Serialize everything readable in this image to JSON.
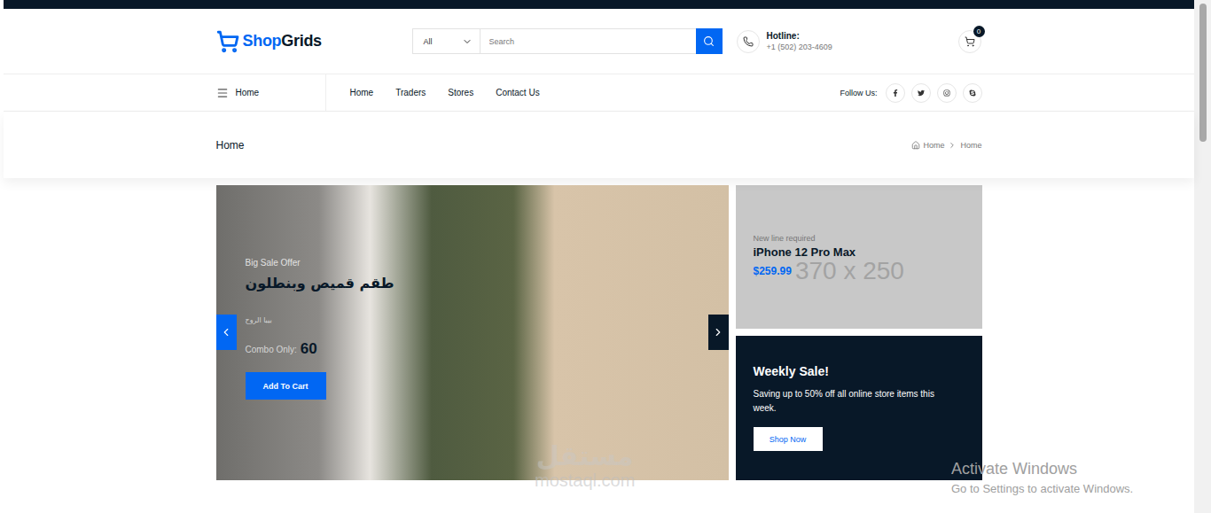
{
  "header": {
    "logo": {
      "first": "Shop",
      "second": "Grids"
    },
    "search": {
      "category": "All",
      "placeholder": "Search"
    },
    "hotline": {
      "label": "Hotline:",
      "number": "+1 (502) 203-4609"
    },
    "cart": {
      "count": "0"
    }
  },
  "nav": {
    "menu_label": "Home",
    "links": [
      {
        "label": "Home",
        "selected": false
      },
      {
        "label": "Traders",
        "selected": false
      },
      {
        "label": "Stores",
        "selected": false
      },
      {
        "label": "Contact Us",
        "selected": false
      }
    ],
    "follow_label": "Follow Us:"
  },
  "page_title": {
    "title": "Home",
    "breadcrumb": [
      "Home",
      "Home"
    ]
  },
  "slider": {
    "tag": "Big Sale Offer",
    "title": "طقم قميص وبنطلون",
    "description": "بيبا الروح",
    "price_label": "Combo Only:",
    "price": "60",
    "button": "Add To Cart"
  },
  "banner": {
    "label": "New line required",
    "title": "iPhone 12 Pro Max",
    "price": "$259.99",
    "placeholder": "370 x 250"
  },
  "weekly_sale": {
    "title": "Weekly Sale!",
    "text": "Saving up to 50% off all online store items this week.",
    "button": "Shop Now"
  },
  "watermark": {
    "logo": "مستقل",
    "site": "mostaql.com"
  },
  "activation": {
    "title": "Activate Windows",
    "text": "Go to Settings to activate Windows."
  }
}
